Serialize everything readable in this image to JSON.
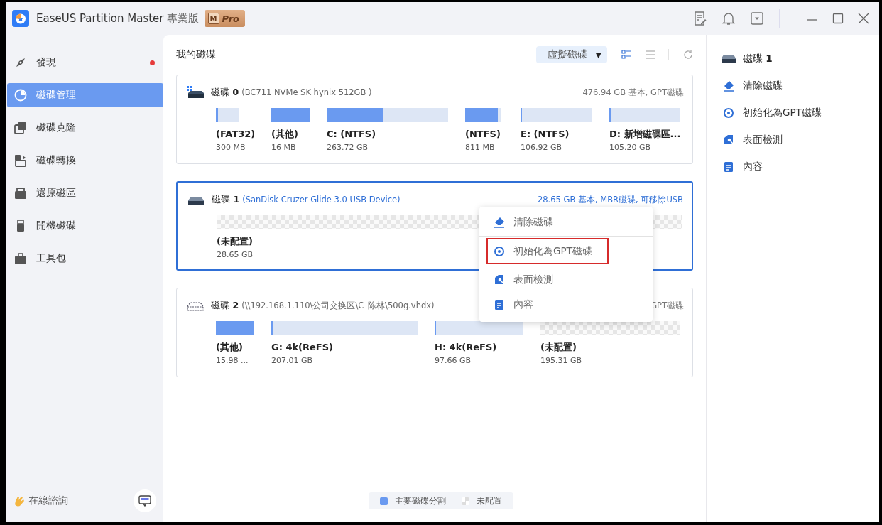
{
  "window": {
    "app_name": "EaseUS Partition Master",
    "edition": "專業版",
    "badge_letter": "M",
    "badge_text": "Pro"
  },
  "sidebar": {
    "items": [
      {
        "label": "發現",
        "selected": false,
        "dot": true
      },
      {
        "label": "磁碟管理",
        "selected": true,
        "dot": false
      },
      {
        "label": "磁碟克隆",
        "selected": false,
        "dot": false
      },
      {
        "label": "磁碟轉換",
        "selected": false,
        "dot": false
      },
      {
        "label": "還原磁區",
        "selected": false,
        "dot": false
      },
      {
        "label": "開機磁碟",
        "selected": false,
        "dot": false
      },
      {
        "label": "工具包",
        "selected": false,
        "dot": false
      }
    ],
    "consult": "在線諮詢"
  },
  "main": {
    "title": "我的磁碟",
    "virtual_disk_button": "虛擬磁碟",
    "dropdown_arrow": "▼",
    "disks": [
      {
        "label": "磁碟",
        "number": "0",
        "model": "(BC711 NVMe SK hynix 512GB )",
        "info": "476.94 GB 基本, GPT磁碟",
        "selected": false,
        "kind": "windows",
        "partitions": [
          {
            "kind": "used",
            "name": "(FAT32)",
            "size": "300 MB",
            "level": 0.08
          },
          {
            "kind": "used",
            "name": "(其他)",
            "size": "16 MB",
            "level": 1
          },
          {
            "kind": "used",
            "name": "C: (NTFS)",
            "size": "263.72 GB",
            "level": 0.47
          },
          {
            "kind": "used",
            "name": "(NTFS)",
            "size": "811 MB",
            "level": 0.92
          },
          {
            "kind": "used",
            "name": "E: (NTFS)",
            "size": "106.92 GB",
            "level": 0.02
          },
          {
            "kind": "used",
            "name": "D: 新增磁碟區...",
            "size": "105.20 GB",
            "level": 0.02
          }
        ]
      },
      {
        "label": "磁碟",
        "number": "1",
        "model": "(SanDisk Cruzer Glide 3.0 USB Device)",
        "info": "28.65 GB 基本, MBR磁碟, 可移除USB",
        "selected": true,
        "kind": "drive",
        "partitions": [
          {
            "kind": "unallocated",
            "name": "(未配置)",
            "size": "28.65 GB"
          }
        ]
      },
      {
        "label": "磁碟",
        "number": "2",
        "model": "(\\\\192.168.1.110\\公司交换区\\C_陈林\\500g.vhdx)",
        "info": "GPT磁碟",
        "selected": false,
        "kind": "virtual",
        "partitions": [
          {
            "kind": "used",
            "name": "(其他)",
            "size": "15.98 ...",
            "level": 1
          },
          {
            "kind": "used",
            "name": "G: 4k(ReFS)",
            "size": "207.01 GB",
            "level": 0.01
          },
          {
            "kind": "used",
            "name": "H: 4k(ReFS)",
            "size": "97.66 GB",
            "level": 0.01
          },
          {
            "kind": "unallocated",
            "name": "(未配置)",
            "size": "195.31 GB"
          }
        ]
      }
    ],
    "context_menu": [
      {
        "label": "清除磁碟",
        "selected": false
      },
      {
        "label": "初始化為GPT磁碟",
        "selected": true
      },
      {
        "label": "表面檢測",
        "selected": false
      },
      {
        "label": "內容",
        "selected": false
      }
    ],
    "legend": [
      {
        "kind": "used",
        "label": "主要磁碟分割"
      },
      {
        "kind": "unallocated",
        "label": "未配置"
      }
    ]
  },
  "right_panel": {
    "disk_label": "磁碟",
    "disk_number": "1",
    "actions": [
      {
        "label": "清除磁碟"
      },
      {
        "label": "初始化為GPT磁碟"
      },
      {
        "label": "表面檢測"
      },
      {
        "label": "內容"
      }
    ]
  }
}
